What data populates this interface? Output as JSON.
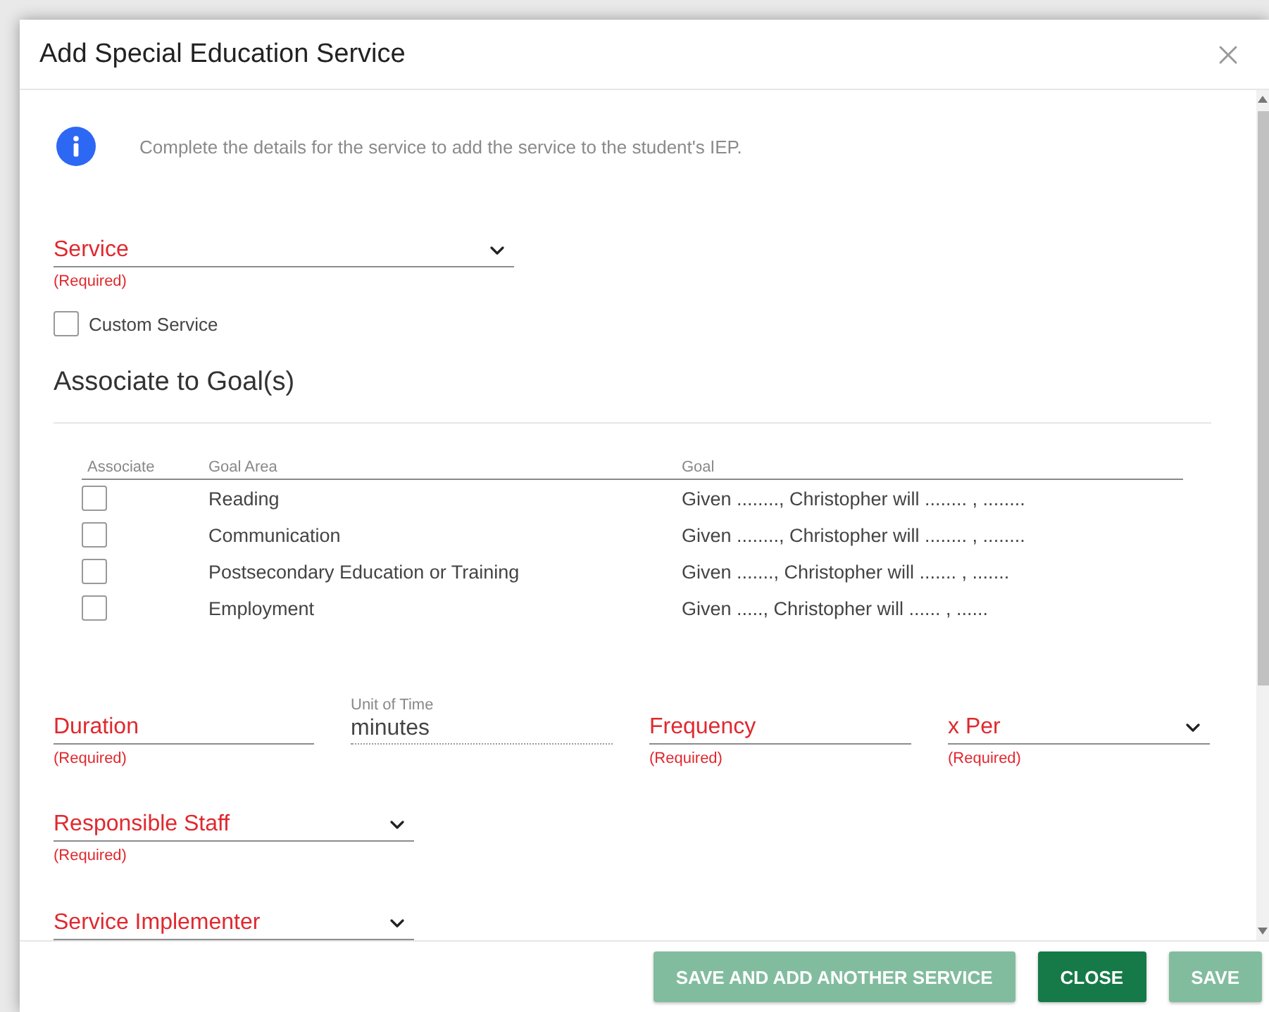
{
  "dialog": {
    "title": "Add Special Education Service"
  },
  "info": "Complete the details for the service to add the service to the student's IEP.",
  "service": {
    "kind": "select",
    "label": "Service",
    "invalid": true,
    "required_note": "(Required)"
  },
  "custom_service": {
    "label": "Custom Service",
    "checked": false
  },
  "goals": {
    "title": "Associate to Goal(s)",
    "columns": [
      "Associate",
      "Goal Area",
      "Goal"
    ],
    "rows": [
      {
        "associated": false,
        "goal_area": "Reading",
        "goal": "Given ........, Christopher will ........ , ........"
      },
      {
        "associated": false,
        "goal_area": "Communication",
        "goal": "Given ........, Christopher will ........ , ........"
      },
      {
        "associated": false,
        "goal_area": "Postsecondary Education or Training",
        "goal": "Given ......., Christopher will ....... , ......."
      },
      {
        "associated": false,
        "goal_area": "Employment",
        "goal": "Given ....., Christopher will ...... , ......"
      }
    ]
  },
  "schedule": [
    {
      "kind": "input",
      "label": "Duration",
      "invalid": true,
      "required_note": "(Required)"
    },
    {
      "kind": "readonly",
      "label": "Unit of Time",
      "value": "minutes",
      "invalid": false
    },
    {
      "kind": "input",
      "label": "Frequency",
      "invalid": true,
      "required_note": "(Required)"
    },
    {
      "kind": "select",
      "label": "x Per",
      "invalid": true,
      "required_note": "(Required)"
    }
  ],
  "responsible_staff": {
    "kind": "select",
    "label": "Responsible Staff",
    "invalid": true,
    "required_note": "(Required)"
  },
  "service_implementer": {
    "kind": "select",
    "label": "Service Implementer",
    "invalid": true
  },
  "buttons": [
    {
      "label": "SAVE AND ADD ANOTHER SERVICE",
      "disabled": true
    },
    {
      "label": "CLOSE",
      "disabled": false
    },
    {
      "label": "SAVE",
      "disabled": true
    }
  ]
}
